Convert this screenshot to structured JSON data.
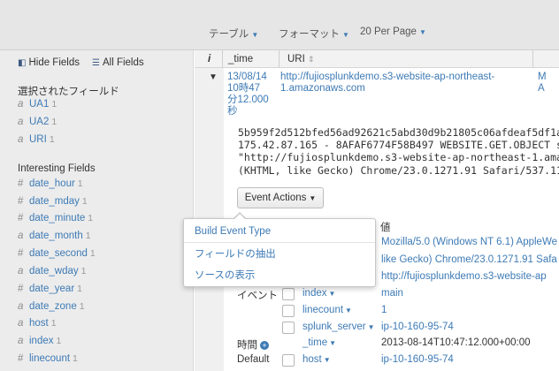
{
  "toolbar": {
    "table_label": "テーブル",
    "format_label": "フォーマット",
    "per_page_label": "20 Per Page"
  },
  "sidebar": {
    "hide_fields": "Hide Fields",
    "all_fields": "All Fields",
    "selected_heading": "選択されたフィールド",
    "selected": [
      {
        "type": "a",
        "name": "UA1",
        "count": "1"
      },
      {
        "type": "a",
        "name": "UA2",
        "count": "1"
      },
      {
        "type": "a",
        "name": "URI",
        "count": "1"
      }
    ],
    "interesting_heading": "Interesting Fields",
    "interesting": [
      {
        "type": "#",
        "name": "date_hour",
        "count": "1"
      },
      {
        "type": "#",
        "name": "date_mday",
        "count": "1"
      },
      {
        "type": "#",
        "name": "date_minute",
        "count": "1"
      },
      {
        "type": "a",
        "name": "date_month",
        "count": "1"
      },
      {
        "type": "#",
        "name": "date_second",
        "count": "1"
      },
      {
        "type": "a",
        "name": "date_wday",
        "count": "1"
      },
      {
        "type": "#",
        "name": "date_year",
        "count": "1"
      },
      {
        "type": "a",
        "name": "date_zone",
        "count": "1"
      },
      {
        "type": "a",
        "name": "host",
        "count": "1"
      },
      {
        "type": "a",
        "name": "index",
        "count": "1"
      },
      {
        "type": "#",
        "name": "linecount",
        "count": "1"
      }
    ]
  },
  "table": {
    "info_header": "i",
    "time_header": "_time",
    "uri_header": "URI",
    "time_lines": [
      "13/08/14",
      "10時47",
      "分12.000",
      "秒"
    ],
    "uri_lines": [
      "http://fujiosplunkdemo.s3-website-ap-northeast-",
      "1.amazonaws.com"
    ],
    "right_lines": [
      "M",
      "A"
    ],
    "raw_lines": [
      "5b959f2d512bfed56ad92621c5abd30d9b21805c06afdeaf5df1a9",
      "175.42.87.165 - 8AFAF6774F58B497 WEBSITE.GET.OBJECT sp",
      "\"http://fujiosplunkdemo.s3-website-ap-northeast-1.amaz",
      "(KHTML, like Gecko) Chrome/23.0.1271.91 Safari/537.11\""
    ]
  },
  "event_actions": {
    "button_label": "Event Actions",
    "menu": [
      "Build Event Type",
      "フィールドの抽出",
      "ソースの表示"
    ]
  },
  "fields": {
    "value_header": "値",
    "value_lines": [
      "Mozilla/5.0 (Windows NT 6.1) AppleWe",
      "like Gecko) Chrome/23.0.1271.91 Safa",
      "http://fujiosplunkdemo.s3-website-ap"
    ],
    "event_label": "イベント",
    "time_label": "時間",
    "default_label": "Default",
    "rows": [
      {
        "name": "index",
        "value": "main"
      },
      {
        "name": "linecount",
        "value": "1"
      },
      {
        "name": "splunk_server",
        "value": "ip-10-160-95-74"
      },
      {
        "name": "_time",
        "value": "2013-08-14T10:47:12.000+00:00"
      },
      {
        "name": "host",
        "value": "ip-10-160-95-74"
      }
    ]
  }
}
